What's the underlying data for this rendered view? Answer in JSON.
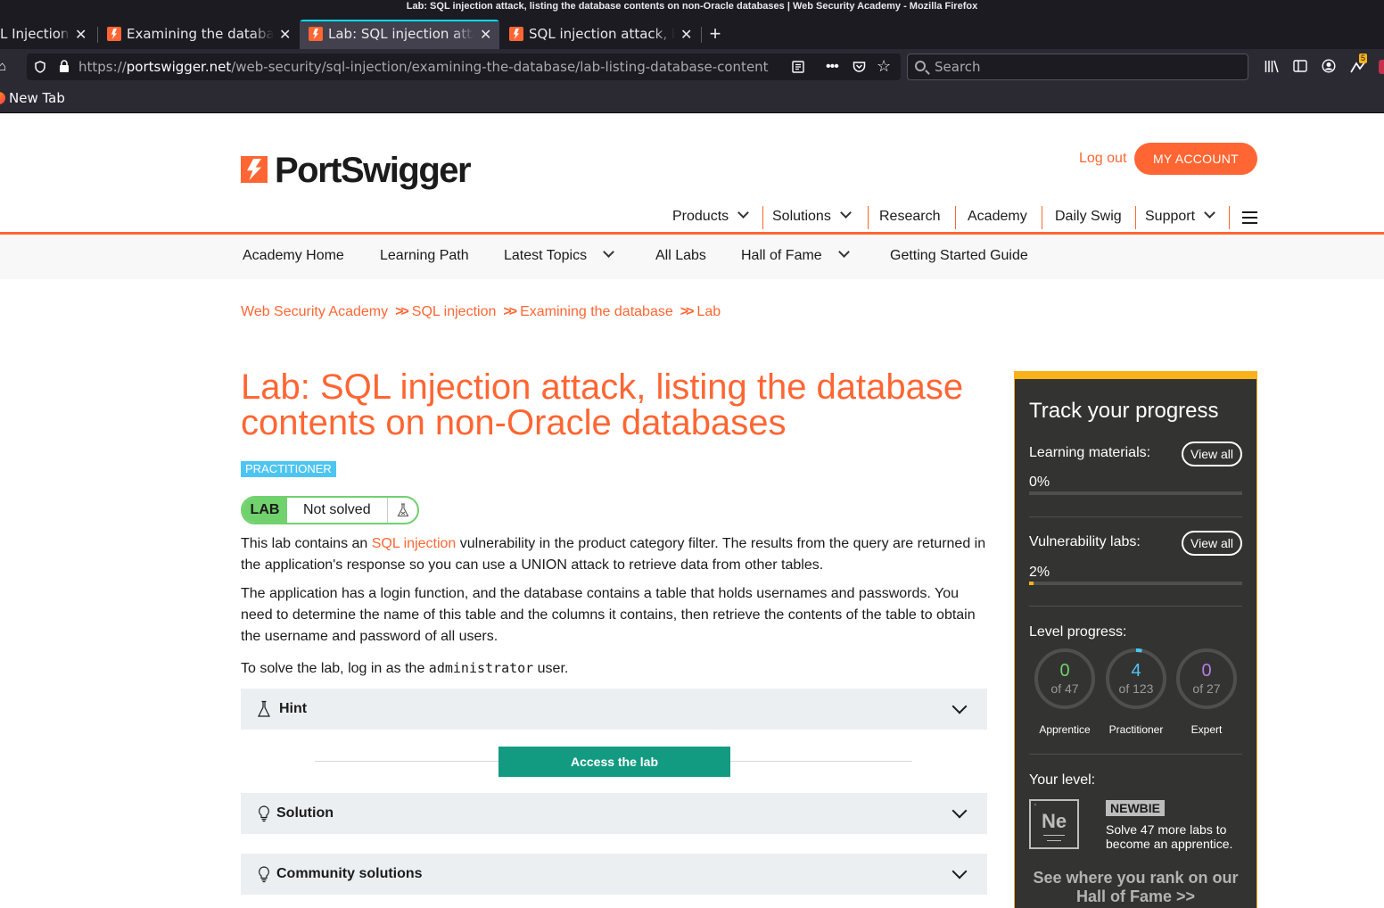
{
  "window": {
    "title": "Lab: SQL injection attack, listing the database contents on non-Oracle databases | Web Security Academy - Mozilla Firefox"
  },
  "tabs": [
    {
      "label": "L Injection?"
    },
    {
      "label": "Examining the database"
    },
    {
      "label": "Lab: SQL injection attack"
    },
    {
      "label": "SQL injection attack, lis"
    }
  ],
  "urlbar": {
    "scheme": "https://",
    "host": "portswigger.net",
    "path": "/web-security/sql-injection/examining-the-database/lab-listing-database-content"
  },
  "searchbar": {
    "placeholder": "Search"
  },
  "bookmarks": [
    {
      "label": "New Tab"
    }
  ],
  "toolbar": {
    "notification_count": "5"
  },
  "header": {
    "logo_text": "PortSwigger",
    "logout_label": "Log out",
    "my_account_label": "MY ACCOUNT"
  },
  "main_nav": {
    "items": [
      "Products",
      "Solutions",
      "Research",
      "Academy",
      "Daily Swig",
      "Support"
    ]
  },
  "sub_nav": {
    "items": [
      "Academy Home",
      "Learning Path",
      "Latest Topics",
      "All Labs",
      "Hall of Fame",
      "Getting Started Guide"
    ]
  },
  "breadcrumb": [
    "Web Security Academy",
    "SQL injection",
    "Examining the database",
    "Lab"
  ],
  "lab": {
    "title": "Lab: SQL injection attack, listing the database contents on non-Oracle databases",
    "level": "PRACTITIONER",
    "status_tag": "LAB",
    "status": "Not solved",
    "p1_before": "This lab contains an ",
    "p1_link": "SQL injection",
    "p1_after": " vulnerability in the product category filter. The results from the query are returned in the application's response so you can use a UNION attack to retrieve data from other tables.",
    "p2": "The application has a login function, and the database contains a table that holds usernames and passwords. You need to determine the name of this table and the columns it contains, then retrieve the contents of the table to obtain the username and password of all users.",
    "p3_before": "To solve the lab, log in as the ",
    "p3_code": "administrator",
    "p3_after": " user.",
    "hint_label": "Hint",
    "access_label": "Access the lab",
    "solution_label": "Solution",
    "community_label": "Community solutions"
  },
  "progress": {
    "title": "Track your progress",
    "learning_label": "Learning materials:",
    "learning_pct": "0%",
    "learning_fraction": 0.0,
    "vuln_label": "Vulnerability labs:",
    "vuln_pct": "2%",
    "vuln_fraction": 0.02,
    "view_all": "View all",
    "level_label": "Level progress:",
    "levels": [
      {
        "count": "0",
        "of": "of 47",
        "name": "Apprentice",
        "color": "#70d16d",
        "fraction": 0.0
      },
      {
        "count": "4",
        "of": "of 123",
        "name": "Practitioner",
        "color": "#4ec5f1",
        "fraction": 0.0325
      },
      {
        "count": "0",
        "of": "of 27",
        "name": "Expert",
        "color": "#b57ee5",
        "fraction": 0.0
      }
    ],
    "your_level_label": "Your level:",
    "level_symbol": "Ne",
    "level_name": "NEWBIE",
    "level_message": "Solve 47 more labs to become an apprentice.",
    "hof_cta": "See where you rank on our Hall of Fame"
  }
}
